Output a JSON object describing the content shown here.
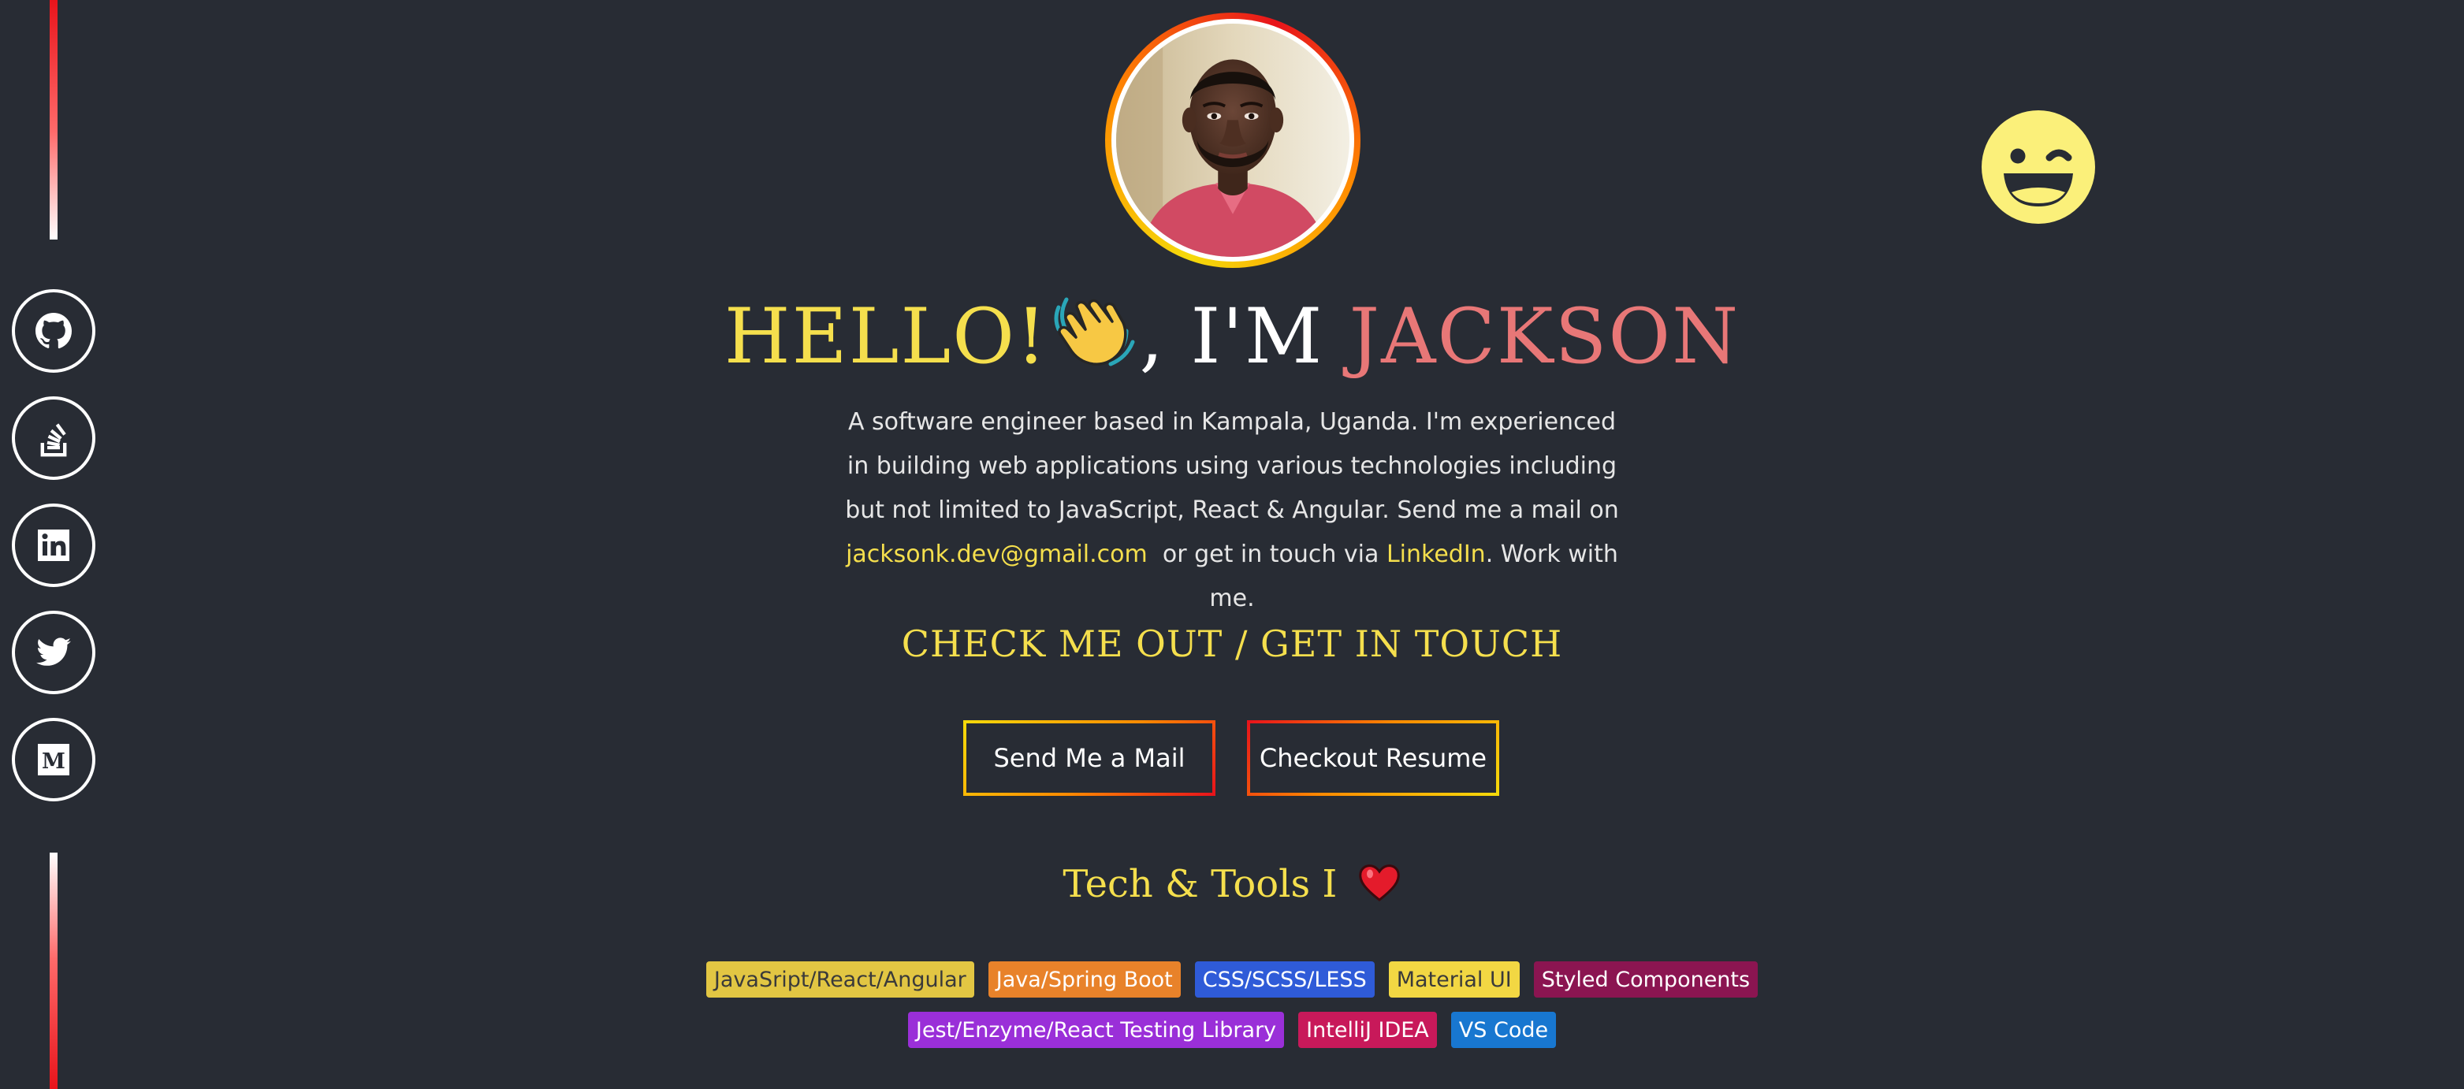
{
  "social": [
    {
      "name": "GitHub",
      "icon": "github-icon"
    },
    {
      "name": "Stack Overflow",
      "icon": "stackoverflow-icon"
    },
    {
      "name": "LinkedIn",
      "icon": "linkedin-icon"
    },
    {
      "name": "Twitter",
      "icon": "twitter-icon"
    },
    {
      "name": "Medium",
      "icon": "medium-icon"
    }
  ],
  "hero": {
    "hello": "HELLO!",
    "wave_icon": "waving-hand-emoji",
    "im": ", I'M ",
    "name": "JACKSON",
    "wink_icon": "winking-face-icon"
  },
  "intro": {
    "text_1": "A software engineer based in Kampala, Uganda. I'm experienced in building web applications using various technologies including but not limited to JavaScript, React & Angular. Send me a mail on",
    "email": "jacksonk.dev@gmail.com",
    "text_2": "or get in touch via",
    "linkedin": "LinkedIn",
    "text_3": ". Work with me."
  },
  "cta": {
    "heading": "CHECK ME OUT / GET IN TOUCH",
    "mail_button": "Send Me a Mail",
    "resume_button": "Checkout Resume"
  },
  "tools": {
    "heading": "Tech & Tools I",
    "heart_icon": "red-heart-emoji",
    "row_1": [
      {
        "label": "JavaSript/React/Angular",
        "bg": "#e2c643",
        "fg": "#3a3a3a"
      },
      {
        "label": "Java/Spring Boot",
        "bg": "#e8822a",
        "fg": "#ffffff"
      },
      {
        "label": "CSS/SCSS/LESS",
        "bg": "#2f5bd8",
        "fg": "#ffffff"
      },
      {
        "label": "Material UI",
        "bg": "#f2d743",
        "fg": "#3a3a3a"
      },
      {
        "label": "Styled Components",
        "bg": "#8b1551",
        "fg": "#ffffff"
      }
    ],
    "row_2": [
      {
        "label": "Jest/Enzyme/React Testing Library",
        "bg": "#9a2fd8",
        "fg": "#ffffff"
      },
      {
        "label": "IntelliJ IDEA",
        "bg": "#c8195a",
        "fg": "#ffffff"
      },
      {
        "label": "VS Code",
        "bg": "#1877d0",
        "fg": "#ffffff"
      }
    ]
  },
  "colors": {
    "background": "#282c34",
    "accent_yellow": "#f5df4d",
    "accent_salmon": "#e87777",
    "accent_red": "#e8141b"
  }
}
